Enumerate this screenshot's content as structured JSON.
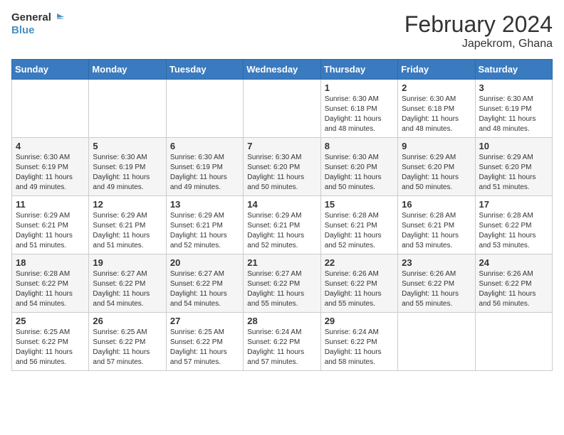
{
  "header": {
    "logo_line1": "General",
    "logo_line2": "Blue",
    "title": "February 2024",
    "subtitle": "Japekrom, Ghana"
  },
  "weekdays": [
    "Sunday",
    "Monday",
    "Tuesday",
    "Wednesday",
    "Thursday",
    "Friday",
    "Saturday"
  ],
  "weeks": [
    [
      {
        "day": "",
        "info": ""
      },
      {
        "day": "",
        "info": ""
      },
      {
        "day": "",
        "info": ""
      },
      {
        "day": "",
        "info": ""
      },
      {
        "day": "1",
        "info": "Sunrise: 6:30 AM\nSunset: 6:18 PM\nDaylight: 11 hours and 48 minutes."
      },
      {
        "day": "2",
        "info": "Sunrise: 6:30 AM\nSunset: 6:18 PM\nDaylight: 11 hours and 48 minutes."
      },
      {
        "day": "3",
        "info": "Sunrise: 6:30 AM\nSunset: 6:19 PM\nDaylight: 11 hours and 48 minutes."
      }
    ],
    [
      {
        "day": "4",
        "info": "Sunrise: 6:30 AM\nSunset: 6:19 PM\nDaylight: 11 hours and 49 minutes."
      },
      {
        "day": "5",
        "info": "Sunrise: 6:30 AM\nSunset: 6:19 PM\nDaylight: 11 hours and 49 minutes."
      },
      {
        "day": "6",
        "info": "Sunrise: 6:30 AM\nSunset: 6:19 PM\nDaylight: 11 hours and 49 minutes."
      },
      {
        "day": "7",
        "info": "Sunrise: 6:30 AM\nSunset: 6:20 PM\nDaylight: 11 hours and 50 minutes."
      },
      {
        "day": "8",
        "info": "Sunrise: 6:30 AM\nSunset: 6:20 PM\nDaylight: 11 hours and 50 minutes."
      },
      {
        "day": "9",
        "info": "Sunrise: 6:29 AM\nSunset: 6:20 PM\nDaylight: 11 hours and 50 minutes."
      },
      {
        "day": "10",
        "info": "Sunrise: 6:29 AM\nSunset: 6:20 PM\nDaylight: 11 hours and 51 minutes."
      }
    ],
    [
      {
        "day": "11",
        "info": "Sunrise: 6:29 AM\nSunset: 6:21 PM\nDaylight: 11 hours and 51 minutes."
      },
      {
        "day": "12",
        "info": "Sunrise: 6:29 AM\nSunset: 6:21 PM\nDaylight: 11 hours and 51 minutes."
      },
      {
        "day": "13",
        "info": "Sunrise: 6:29 AM\nSunset: 6:21 PM\nDaylight: 11 hours and 52 minutes."
      },
      {
        "day": "14",
        "info": "Sunrise: 6:29 AM\nSunset: 6:21 PM\nDaylight: 11 hours and 52 minutes."
      },
      {
        "day": "15",
        "info": "Sunrise: 6:28 AM\nSunset: 6:21 PM\nDaylight: 11 hours and 52 minutes."
      },
      {
        "day": "16",
        "info": "Sunrise: 6:28 AM\nSunset: 6:21 PM\nDaylight: 11 hours and 53 minutes."
      },
      {
        "day": "17",
        "info": "Sunrise: 6:28 AM\nSunset: 6:22 PM\nDaylight: 11 hours and 53 minutes."
      }
    ],
    [
      {
        "day": "18",
        "info": "Sunrise: 6:28 AM\nSunset: 6:22 PM\nDaylight: 11 hours and 54 minutes."
      },
      {
        "day": "19",
        "info": "Sunrise: 6:27 AM\nSunset: 6:22 PM\nDaylight: 11 hours and 54 minutes."
      },
      {
        "day": "20",
        "info": "Sunrise: 6:27 AM\nSunset: 6:22 PM\nDaylight: 11 hours and 54 minutes."
      },
      {
        "day": "21",
        "info": "Sunrise: 6:27 AM\nSunset: 6:22 PM\nDaylight: 11 hours and 55 minutes."
      },
      {
        "day": "22",
        "info": "Sunrise: 6:26 AM\nSunset: 6:22 PM\nDaylight: 11 hours and 55 minutes."
      },
      {
        "day": "23",
        "info": "Sunrise: 6:26 AM\nSunset: 6:22 PM\nDaylight: 11 hours and 55 minutes."
      },
      {
        "day": "24",
        "info": "Sunrise: 6:26 AM\nSunset: 6:22 PM\nDaylight: 11 hours and 56 minutes."
      }
    ],
    [
      {
        "day": "25",
        "info": "Sunrise: 6:25 AM\nSunset: 6:22 PM\nDaylight: 11 hours and 56 minutes."
      },
      {
        "day": "26",
        "info": "Sunrise: 6:25 AM\nSunset: 6:22 PM\nDaylight: 11 hours and 57 minutes."
      },
      {
        "day": "27",
        "info": "Sunrise: 6:25 AM\nSunset: 6:22 PM\nDaylight: 11 hours and 57 minutes."
      },
      {
        "day": "28",
        "info": "Sunrise: 6:24 AM\nSunset: 6:22 PM\nDaylight: 11 hours and 57 minutes."
      },
      {
        "day": "29",
        "info": "Sunrise: 6:24 AM\nSunset: 6:22 PM\nDaylight: 11 hours and 58 minutes."
      },
      {
        "day": "",
        "info": ""
      },
      {
        "day": "",
        "info": ""
      }
    ]
  ]
}
